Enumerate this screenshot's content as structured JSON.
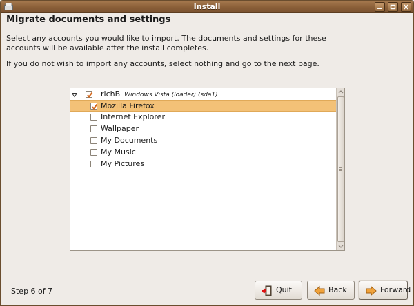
{
  "window": {
    "title": "Install",
    "controls": [
      "minimize",
      "maximize",
      "close"
    ]
  },
  "page": {
    "heading": "Migrate documents and settings",
    "description_line1": "Select any accounts you would like to import.  The documents and settings for these",
    "description_line2": "accounts will be available after the install completes.",
    "instruction": "If you do not wish to import any accounts, select nothing and go to the next page."
  },
  "tree": {
    "account": {
      "name": "richB",
      "detail": "Windows Vista (loader) (sda1)",
      "checked": true,
      "expanded": true
    },
    "items": [
      {
        "label": "Mozilla Firefox",
        "checked": true,
        "selected": true
      },
      {
        "label": "Internet Explorer",
        "checked": false,
        "selected": false
      },
      {
        "label": "Wallpaper",
        "checked": false,
        "selected": false
      },
      {
        "label": "My Documents",
        "checked": false,
        "selected": false
      },
      {
        "label": "My Music",
        "checked": false,
        "selected": false
      },
      {
        "label": "My Pictures",
        "checked": false,
        "selected": false
      }
    ]
  },
  "footer": {
    "step": "Step 6 of 7",
    "quit": "Quit",
    "back": "Back",
    "forward": "Forward"
  },
  "colors": {
    "titlebar": "#8a5f38",
    "selection": "#f3c177",
    "check": "#d4661a"
  }
}
